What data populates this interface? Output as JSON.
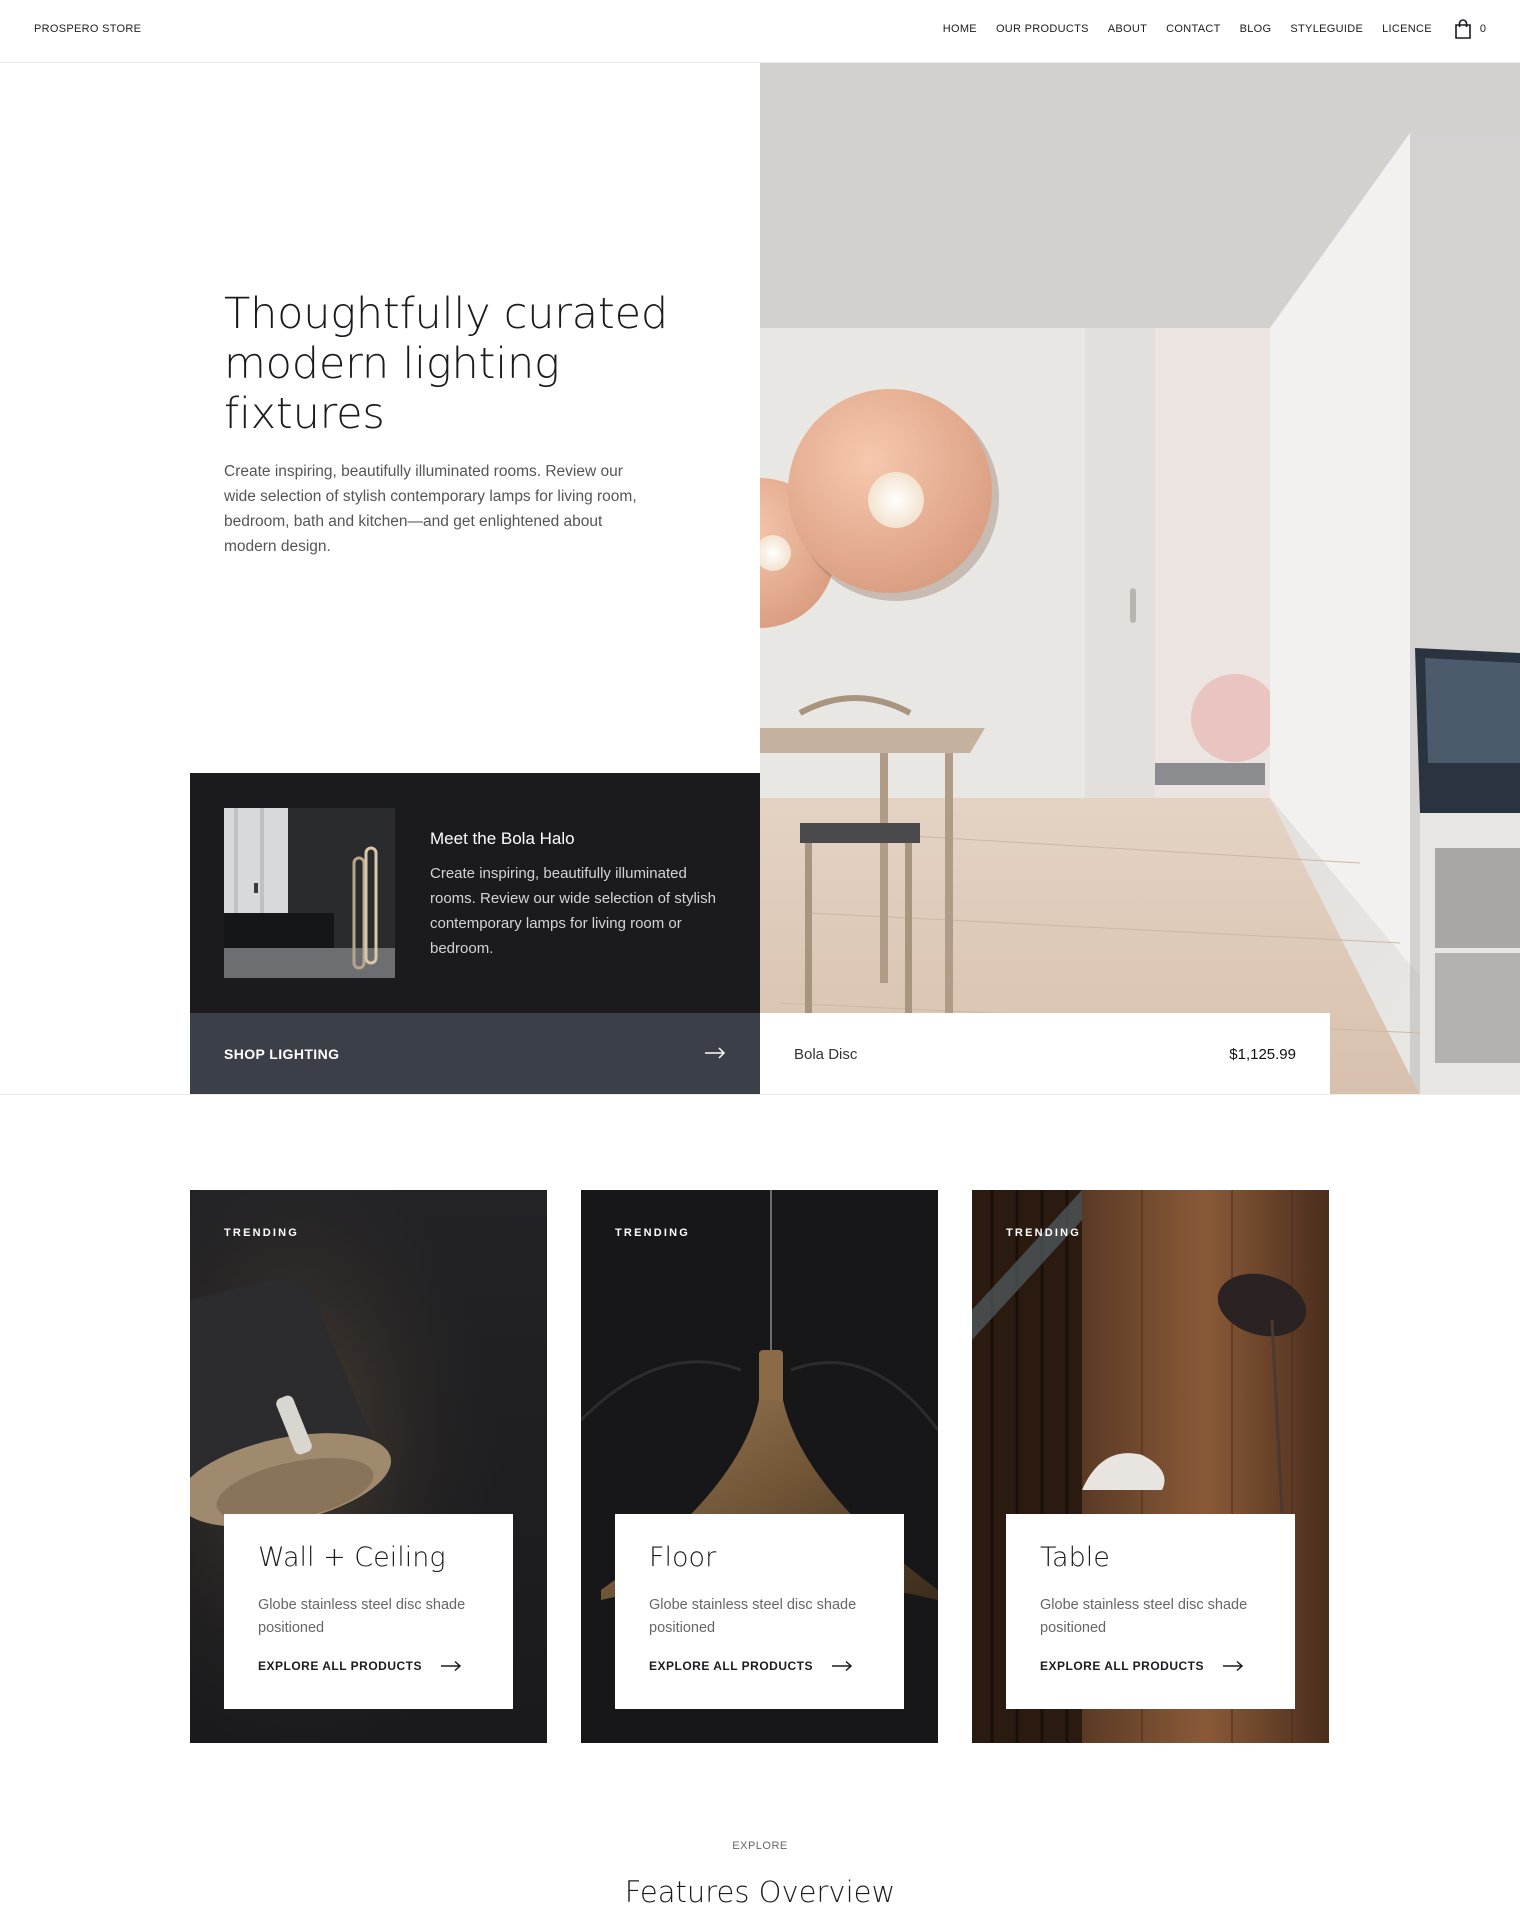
{
  "header": {
    "brand": "PROSPERO STORE",
    "nav": [
      "HOME",
      "OUR PRODUCTS",
      "ABOUT",
      "CONTACT",
      "BLOG",
      "STYLEGUIDE",
      "LICENCE"
    ],
    "cart_count": "0",
    "cart_icon": "shopping-bag-icon"
  },
  "hero": {
    "title": "Thoughtfully curated modern lighting fixtures",
    "description": "Create inspiring, beautifully illuminated rooms. Review our wide selection of stylish contemporary lamps for living room, bedroom, bath and kitchen—and get enlightened about modern design."
  },
  "feature": {
    "title": "Meet the Bola Halo",
    "description": "Create inspiring, beautifully illuminated rooms. Review our wide selection of stylish contemporary lamps for living room or bedroom.",
    "cta": "SHOP LIGHTING",
    "cta_icon": "arrow-right-icon"
  },
  "product": {
    "name": "Bola Disc",
    "price": "$1,125.99"
  },
  "trending": [
    {
      "label": "TRENDING",
      "title": "Wall + Ceiling",
      "description": "Globe stainless steel disc shade positioned",
      "link": "EXPLORE ALL PRODUCTS"
    },
    {
      "label": "TRENDING",
      "title": "Floor",
      "description": "Globe stainless steel disc shade positioned",
      "link": "EXPLORE ALL PRODUCTS"
    },
    {
      "label": "TRENDING",
      "title": "Table",
      "description": "Globe stainless steel disc shade positioned",
      "link": "EXPLORE ALL PRODUCTS"
    }
  ],
  "explore": {
    "label": "EXPLORE",
    "title": "Features Overview"
  },
  "colors": {
    "dark_card": "#1b1a1f",
    "shop_bar": "#3b3f47",
    "accent_disc": "#e9b59a"
  }
}
